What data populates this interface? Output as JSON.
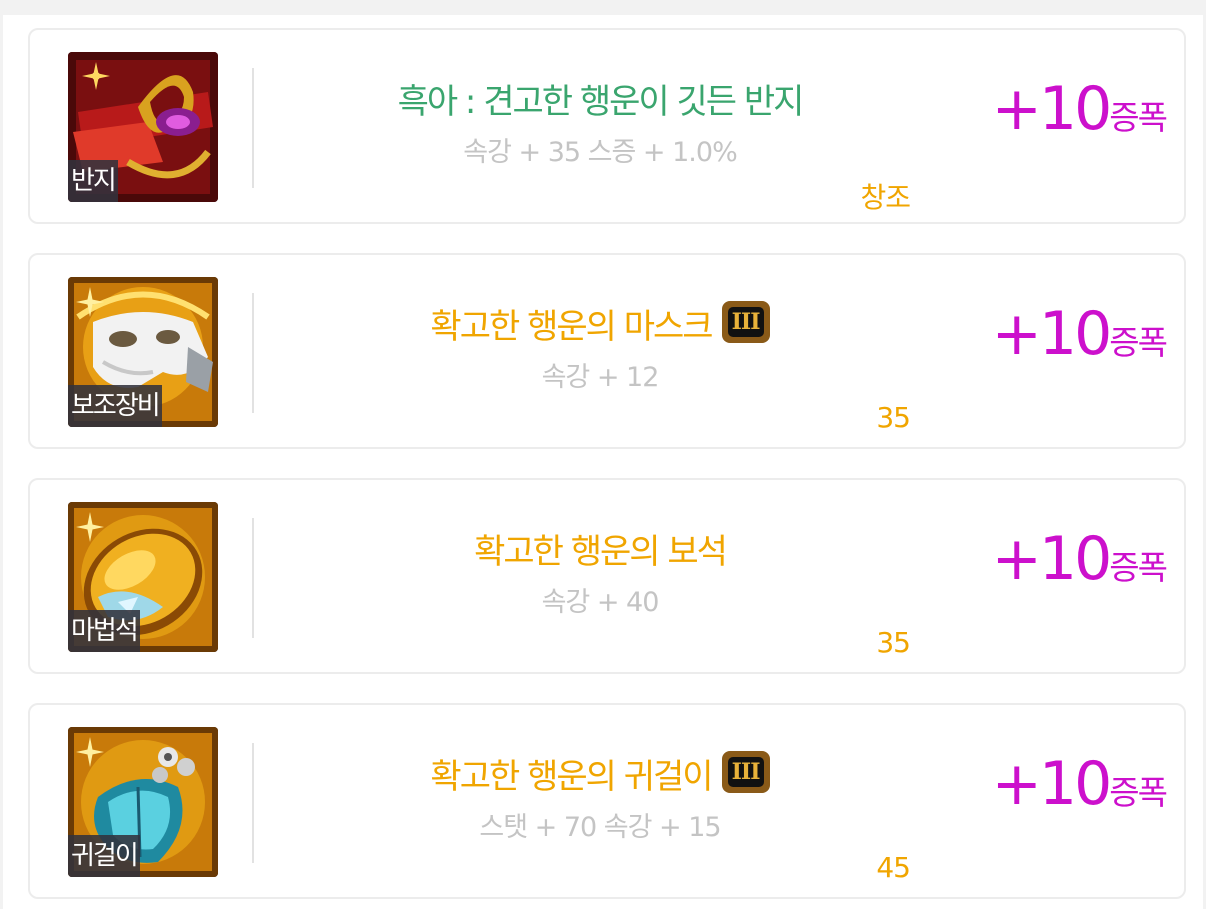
{
  "colors": {
    "unique_green": "#3aa56e",
    "epic_gold": "#f0a500",
    "amplify_magenta": "#cc10cc",
    "stat_gray": "#c4c4c4"
  },
  "items": [
    {
      "slot": "반지",
      "name": "흑아 : 견고한 행운이 깃든 반지",
      "name_color": "#3aa56e",
      "stats": "속강 + 35 스증 + 1.0%",
      "source": "창조",
      "amp_value": "+10",
      "amp_unit": "증폭",
      "tier_badge": "",
      "icon": "ring-icon"
    },
    {
      "slot": "보조장비",
      "name": "확고한 행운의 마스크",
      "name_color": "#f0a500",
      "stats": "속강 + 12",
      "source": "35",
      "amp_value": "+10",
      "amp_unit": "증폭",
      "tier_badge": "III",
      "icon": "mask-icon"
    },
    {
      "slot": "마법석",
      "name": "확고한 행운의 보석",
      "name_color": "#f0a500",
      "stats": "속강 + 40",
      "source": "35",
      "amp_value": "+10",
      "amp_unit": "증폭",
      "tier_badge": "",
      "icon": "gem-icon"
    },
    {
      "slot": "귀걸이",
      "name": "확고한 행운의 귀걸이",
      "name_color": "#f0a500",
      "stats": "스탯 + 70 속강 + 15",
      "source": "45",
      "amp_value": "+10",
      "amp_unit": "증폭",
      "tier_badge": "III",
      "icon": "earring-icon"
    }
  ]
}
